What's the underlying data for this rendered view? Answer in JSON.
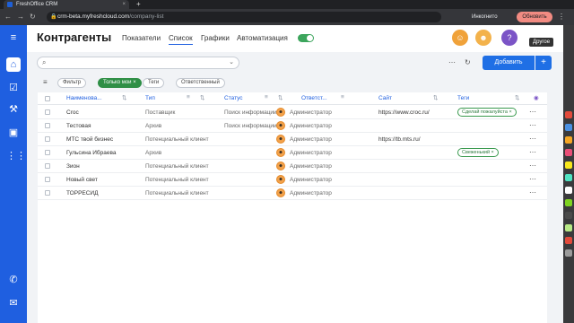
{
  "browser": {
    "tab_title": "FreshOffice CRM",
    "tab_close": "×",
    "new_tab": "+",
    "back": "←",
    "forward": "→",
    "reload": "↻",
    "url_host": "crm-beta.myfreshcloud.com",
    "url_path": "/company-list",
    "incognito_label": "Инкогнито",
    "update_button": "Обновить",
    "menu": "⋮"
  },
  "nav": {
    "items": [
      {
        "icon": "home-icon",
        "glyph": "⌂"
      },
      {
        "icon": "checklist-icon",
        "glyph": "☑"
      },
      {
        "icon": "hammer-icon",
        "glyph": "⚒"
      },
      {
        "icon": "box-icon",
        "glyph": "▣"
      },
      {
        "icon": "apps-grid-icon",
        "glyph": "⋮⋮"
      },
      {
        "icon": "phone-icon",
        "glyph": "✆"
      },
      {
        "icon": "mail-icon",
        "glyph": "✉"
      }
    ],
    "menu_glyph": "≡"
  },
  "header": {
    "title": "Контрагенты",
    "tabs": [
      "Показатели",
      "Список",
      "Графики",
      "Автоматизация"
    ],
    "active_tab": "Список",
    "tooltip": "Другое"
  },
  "toolbar": {
    "search_placeholder": "",
    "add_label": "Добавить",
    "plus": "+",
    "more": "⋯",
    "refresh": "↻"
  },
  "filters": {
    "items": [
      "Фильтр",
      "Только мои",
      "Теги",
      "Ответственный"
    ],
    "active": "Только мои"
  },
  "table": {
    "columns": [
      "Наименова...",
      "Тип",
      "Статус",
      "Ответст...",
      "Сайт",
      "Теги"
    ],
    "rows": [
      {
        "name": "Croc",
        "type": "Поставщик",
        "status": "Поиск информации",
        "owner": "Администратор",
        "site": "https://www.croc.ru/",
        "tag": "Сделай пожалуйста"
      },
      {
        "name": "Тестовая",
        "type": "Архив",
        "status": "Поиск информации",
        "owner": "Администратор",
        "site": "",
        "tag": ""
      },
      {
        "name": "МТС твой бизнес",
        "type": "Потенциальный клиент",
        "status": "",
        "owner": "Администратор",
        "site": "https://tb.mts.ru/",
        "tag": ""
      },
      {
        "name": "Гульсина Ибраева",
        "type": "Архив",
        "status": "",
        "owner": "Администратор",
        "site": "",
        "tag": "Свеженький"
      },
      {
        "name": "Зион",
        "type": "Потенциальный клиент",
        "status": "",
        "owner": "Администратор",
        "site": "",
        "tag": ""
      },
      {
        "name": "Новый свет",
        "type": "Потенциальный клиент",
        "status": "",
        "owner": "Администратор",
        "site": "",
        "tag": ""
      },
      {
        "name": "ТОРРЕСИД",
        "type": "Потенциальный клиент",
        "status": "",
        "owner": "Администратор",
        "site": "",
        "tag": ""
      }
    ],
    "row_menu": "⋯"
  },
  "colors": {
    "brand": "#1f5fe0",
    "add_button": "#1f6fe5",
    "active_filter": "#2f8f46",
    "tag_border": "#3a9a4f",
    "update_button": "#f28b82"
  }
}
